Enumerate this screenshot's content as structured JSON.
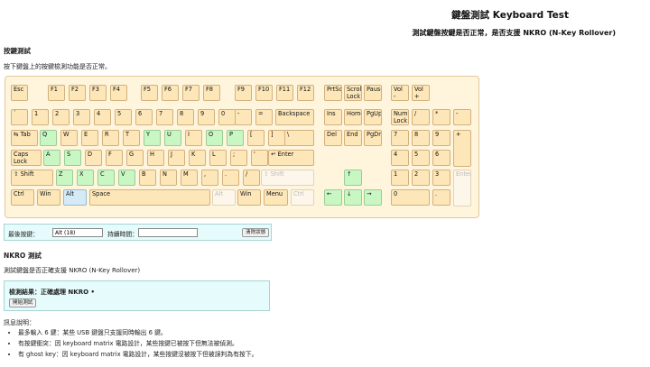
{
  "header": {
    "title": "鍵盤測試 Keyboard Test",
    "subtitle": "測試鍵盤按鍵是否正常，是否支援 NKRO (N-Key Rollover)"
  },
  "key_test": {
    "heading": "按鍵測試",
    "instructions": "按下鍵盤上的按鍵檢測功能是否正常。"
  },
  "keyboard": {
    "keys": [
      {
        "id": "esc",
        "label": "Esc",
        "state": "idle"
      },
      {
        "id": "f1",
        "label": "F1",
        "state": "idle"
      },
      {
        "id": "f2",
        "label": "F2",
        "state": "idle"
      },
      {
        "id": "f3",
        "label": "F3",
        "state": "idle"
      },
      {
        "id": "f4",
        "label": "F4",
        "state": "idle"
      },
      {
        "id": "f5",
        "label": "F5",
        "state": "idle"
      },
      {
        "id": "f6",
        "label": "F6",
        "state": "idle"
      },
      {
        "id": "f7",
        "label": "F7",
        "state": "idle"
      },
      {
        "id": "f8",
        "label": "F8",
        "state": "idle"
      },
      {
        "id": "f9",
        "label": "F9",
        "state": "idle"
      },
      {
        "id": "f10",
        "label": "F10",
        "state": "idle"
      },
      {
        "id": "f11",
        "label": "F11",
        "state": "idle"
      },
      {
        "id": "f12",
        "label": "F12",
        "state": "idle"
      },
      {
        "id": "prtsc",
        "label": "PrtSc",
        "state": "idle"
      },
      {
        "id": "scroll",
        "label": "Scroll\nLock",
        "state": "idle"
      },
      {
        "id": "pause",
        "label": "Pause",
        "state": "idle"
      },
      {
        "id": "vol-down",
        "label": "Vol -",
        "state": "idle"
      },
      {
        "id": "vol-up",
        "label": "Vol\n+",
        "state": "idle"
      },
      {
        "id": "backtick",
        "label": "`",
        "state": "idle"
      },
      {
        "id": "d1",
        "label": "1",
        "state": "idle"
      },
      {
        "id": "d2",
        "label": "2",
        "state": "idle"
      },
      {
        "id": "d3",
        "label": "3",
        "state": "idle"
      },
      {
        "id": "d4",
        "label": "4",
        "state": "idle"
      },
      {
        "id": "d5",
        "label": "5",
        "state": "idle"
      },
      {
        "id": "d6",
        "label": "6",
        "state": "idle"
      },
      {
        "id": "d7",
        "label": "7",
        "state": "idle"
      },
      {
        "id": "d8",
        "label": "8",
        "state": "idle"
      },
      {
        "id": "d9",
        "label": "9",
        "state": "idle"
      },
      {
        "id": "d0",
        "label": "0",
        "state": "idle"
      },
      {
        "id": "minus",
        "label": "-",
        "state": "idle"
      },
      {
        "id": "equal",
        "label": "=",
        "state": "idle"
      },
      {
        "id": "backspace",
        "label": "Backspace",
        "state": "idle"
      },
      {
        "id": "ins",
        "label": "Ins",
        "state": "idle"
      },
      {
        "id": "home",
        "label": "Home",
        "state": "idle"
      },
      {
        "id": "pgup",
        "label": "PgUp",
        "state": "idle"
      },
      {
        "id": "numlock",
        "label": "Num\nLock",
        "state": "idle"
      },
      {
        "id": "np-div",
        "label": "/",
        "state": "idle"
      },
      {
        "id": "np-mul",
        "label": "*",
        "state": "idle"
      },
      {
        "id": "np-sub",
        "label": "-",
        "state": "idle"
      },
      {
        "id": "tab",
        "label": "⇆ Tab",
        "state": "idle"
      },
      {
        "id": "q",
        "label": "Q",
        "state": "ok"
      },
      {
        "id": "w",
        "label": "W",
        "state": "idle"
      },
      {
        "id": "e",
        "label": "E",
        "state": "idle"
      },
      {
        "id": "r",
        "label": "R",
        "state": "idle"
      },
      {
        "id": "t",
        "label": "T",
        "state": "idle"
      },
      {
        "id": "y",
        "label": "Y",
        "state": "ok"
      },
      {
        "id": "u",
        "label": "U",
        "state": "ok"
      },
      {
        "id": "i",
        "label": "I",
        "state": "idle"
      },
      {
        "id": "o",
        "label": "O",
        "state": "ok"
      },
      {
        "id": "p",
        "label": "P",
        "state": "ok"
      },
      {
        "id": "lbracket",
        "label": "[",
        "state": "idle"
      },
      {
        "id": "rbracket",
        "label": "]",
        "state": "idle"
      },
      {
        "id": "backslash",
        "label": "\\",
        "state": "idle"
      },
      {
        "id": "del",
        "label": "Del",
        "state": "idle"
      },
      {
        "id": "end",
        "label": "End",
        "state": "idle"
      },
      {
        "id": "pgdn",
        "label": "PgDn",
        "state": "idle"
      },
      {
        "id": "np7",
        "label": "7",
        "state": "idle"
      },
      {
        "id": "np8",
        "label": "8",
        "state": "idle"
      },
      {
        "id": "np9",
        "label": "9",
        "state": "idle"
      },
      {
        "id": "np-add",
        "label": "+",
        "state": "idle"
      },
      {
        "id": "caps",
        "label": "Caps\nLock",
        "state": "idle"
      },
      {
        "id": "a",
        "label": "A",
        "state": "ok"
      },
      {
        "id": "s",
        "label": "S",
        "state": "ok"
      },
      {
        "id": "d",
        "label": "D",
        "state": "idle"
      },
      {
        "id": "f",
        "label": "F",
        "state": "idle"
      },
      {
        "id": "g",
        "label": "G",
        "state": "idle"
      },
      {
        "id": "h",
        "label": "H",
        "state": "idle"
      },
      {
        "id": "j",
        "label": "J",
        "state": "idle"
      },
      {
        "id": "k",
        "label": "K",
        "state": "idle"
      },
      {
        "id": "l",
        "label": "L",
        "state": "idle"
      },
      {
        "id": "semicolon",
        "label": ";",
        "state": "idle"
      },
      {
        "id": "quote",
        "label": "'",
        "state": "idle"
      },
      {
        "id": "enter",
        "label": "↵ Enter",
        "state": "idle"
      },
      {
        "id": "np4",
        "label": "4",
        "state": "idle"
      },
      {
        "id": "np5",
        "label": "5",
        "state": "idle"
      },
      {
        "id": "np6",
        "label": "6",
        "state": "idle"
      },
      {
        "id": "lshift",
        "label": "⇧ Shift",
        "state": "idle"
      },
      {
        "id": "z",
        "label": "Z",
        "state": "ok"
      },
      {
        "id": "x",
        "label": "X",
        "state": "ok"
      },
      {
        "id": "c",
        "label": "C",
        "state": "ok"
      },
      {
        "id": "v",
        "label": "V",
        "state": "ok"
      },
      {
        "id": "b",
        "label": "B",
        "state": "idle"
      },
      {
        "id": "n",
        "label": "N",
        "state": "idle"
      },
      {
        "id": "m",
        "label": "M",
        "state": "idle"
      },
      {
        "id": "comma",
        "label": ",",
        "state": "idle"
      },
      {
        "id": "period",
        "label": ".",
        "state": "idle"
      },
      {
        "id": "slash",
        "label": "/",
        "state": "idle"
      },
      {
        "id": "rshift",
        "label": "⇧ Shift",
        "state": "dim"
      },
      {
        "id": "up",
        "label": "↑",
        "state": "ok"
      },
      {
        "id": "np1",
        "label": "1",
        "state": "idle"
      },
      {
        "id": "np2",
        "label": "2",
        "state": "idle"
      },
      {
        "id": "np3",
        "label": "3",
        "state": "idle"
      },
      {
        "id": "np-enter",
        "label": "Enter",
        "state": "dim"
      },
      {
        "id": "lctrl",
        "label": "Ctrl",
        "state": "idle"
      },
      {
        "id": "lwin",
        "label": "Win",
        "state": "idle"
      },
      {
        "id": "lalt",
        "label": "Alt",
        "state": "pr"
      },
      {
        "id": "space",
        "label": "Space",
        "state": "idle"
      },
      {
        "id": "ralt",
        "label": "Alt",
        "state": "dim"
      },
      {
        "id": "rwin",
        "label": "Win",
        "state": "idle"
      },
      {
        "id": "menu",
        "label": "Menu",
        "state": "idle"
      },
      {
        "id": "rctrl",
        "label": "Ctrl",
        "state": "dim"
      },
      {
        "id": "left",
        "label": "←",
        "state": "ok"
      },
      {
        "id": "down",
        "label": "↓",
        "state": "ok"
      },
      {
        "id": "right",
        "label": "→",
        "state": "ok"
      },
      {
        "id": "np0",
        "label": "0",
        "state": "idle"
      },
      {
        "id": "np-dot",
        "label": ".",
        "state": "idle"
      }
    ]
  },
  "controls": {
    "last_key_label": "最後按鍵：",
    "last_key_value": "Alt (18)",
    "duration_label": "持續時間：",
    "duration_value": "",
    "clear_button": "清除狀態"
  },
  "nkro": {
    "heading": "NKRO 測試",
    "description": "測試鍵盤是否正確支援 NKRO (N-Key Rollover)",
    "result": "檢測結果：正確處理 NKRO •",
    "start_button": "開始測試"
  },
  "notes": {
    "title": "訊息說明：",
    "items": [
      "最多輸入 6 鍵：某些 USB 鍵盤只支援同時輸出 6 鍵。",
      "有按鍵衝突：因 keyboard matrix 電路設計，某些按鍵已被按下但無法被偵測。",
      "有 ghost key：因 keyboard matrix 電路設計，某些按鍵沒被按下但被誤判為有按下。"
    ]
  }
}
